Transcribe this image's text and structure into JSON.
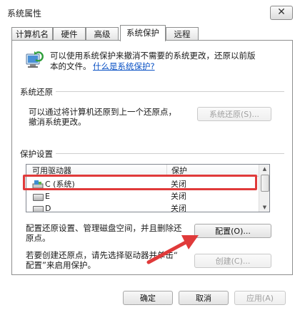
{
  "window": {
    "title": "系统属性",
    "close_glyph": "✕"
  },
  "tabs": [
    {
      "label": "计算机名"
    },
    {
      "label": "硬件"
    },
    {
      "label": "高级"
    },
    {
      "label": "系统保护",
      "active": true
    },
    {
      "label": "远程"
    }
  ],
  "intro": {
    "line1": "可以使用系统保护来撤消不需要的系统更改，还原以前版",
    "line2": "本的文件。",
    "link": "什么是系统保护?"
  },
  "system_restore": {
    "group_title": "系统还原",
    "line1": "可以通过将计算机还原到上一个还原点，",
    "line2": "撤消系统更改。",
    "button": "系统还原(S)..."
  },
  "protection": {
    "group_title": "保护设置",
    "columns": [
      "可用驱动器",
      "保护"
    ],
    "rows": [
      {
        "drive": "C (系统)",
        "protection": "关闭",
        "icon": "system-drive-icon"
      },
      {
        "drive": "E",
        "protection": "关闭",
        "icon": "drive-icon"
      },
      {
        "drive": "D",
        "protection": "关闭",
        "icon": "drive-icon"
      }
    ],
    "configure_text_line1": "配置还原设置、管理磁盘空间，并且删除还",
    "configure_text_line2": "原点。",
    "configure_button": "配置(O)...",
    "create_text_line1": "若要创建还原点，请先选择驱动器并单击“",
    "create_text_line2": "配置”来启用保护。",
    "create_button": "创建(C)..."
  },
  "footer": {
    "ok": "确定",
    "cancel": "取消",
    "apply": "应用(A)"
  },
  "colors": {
    "highlight": "#e03a3a",
    "link": "#0b52c5"
  }
}
